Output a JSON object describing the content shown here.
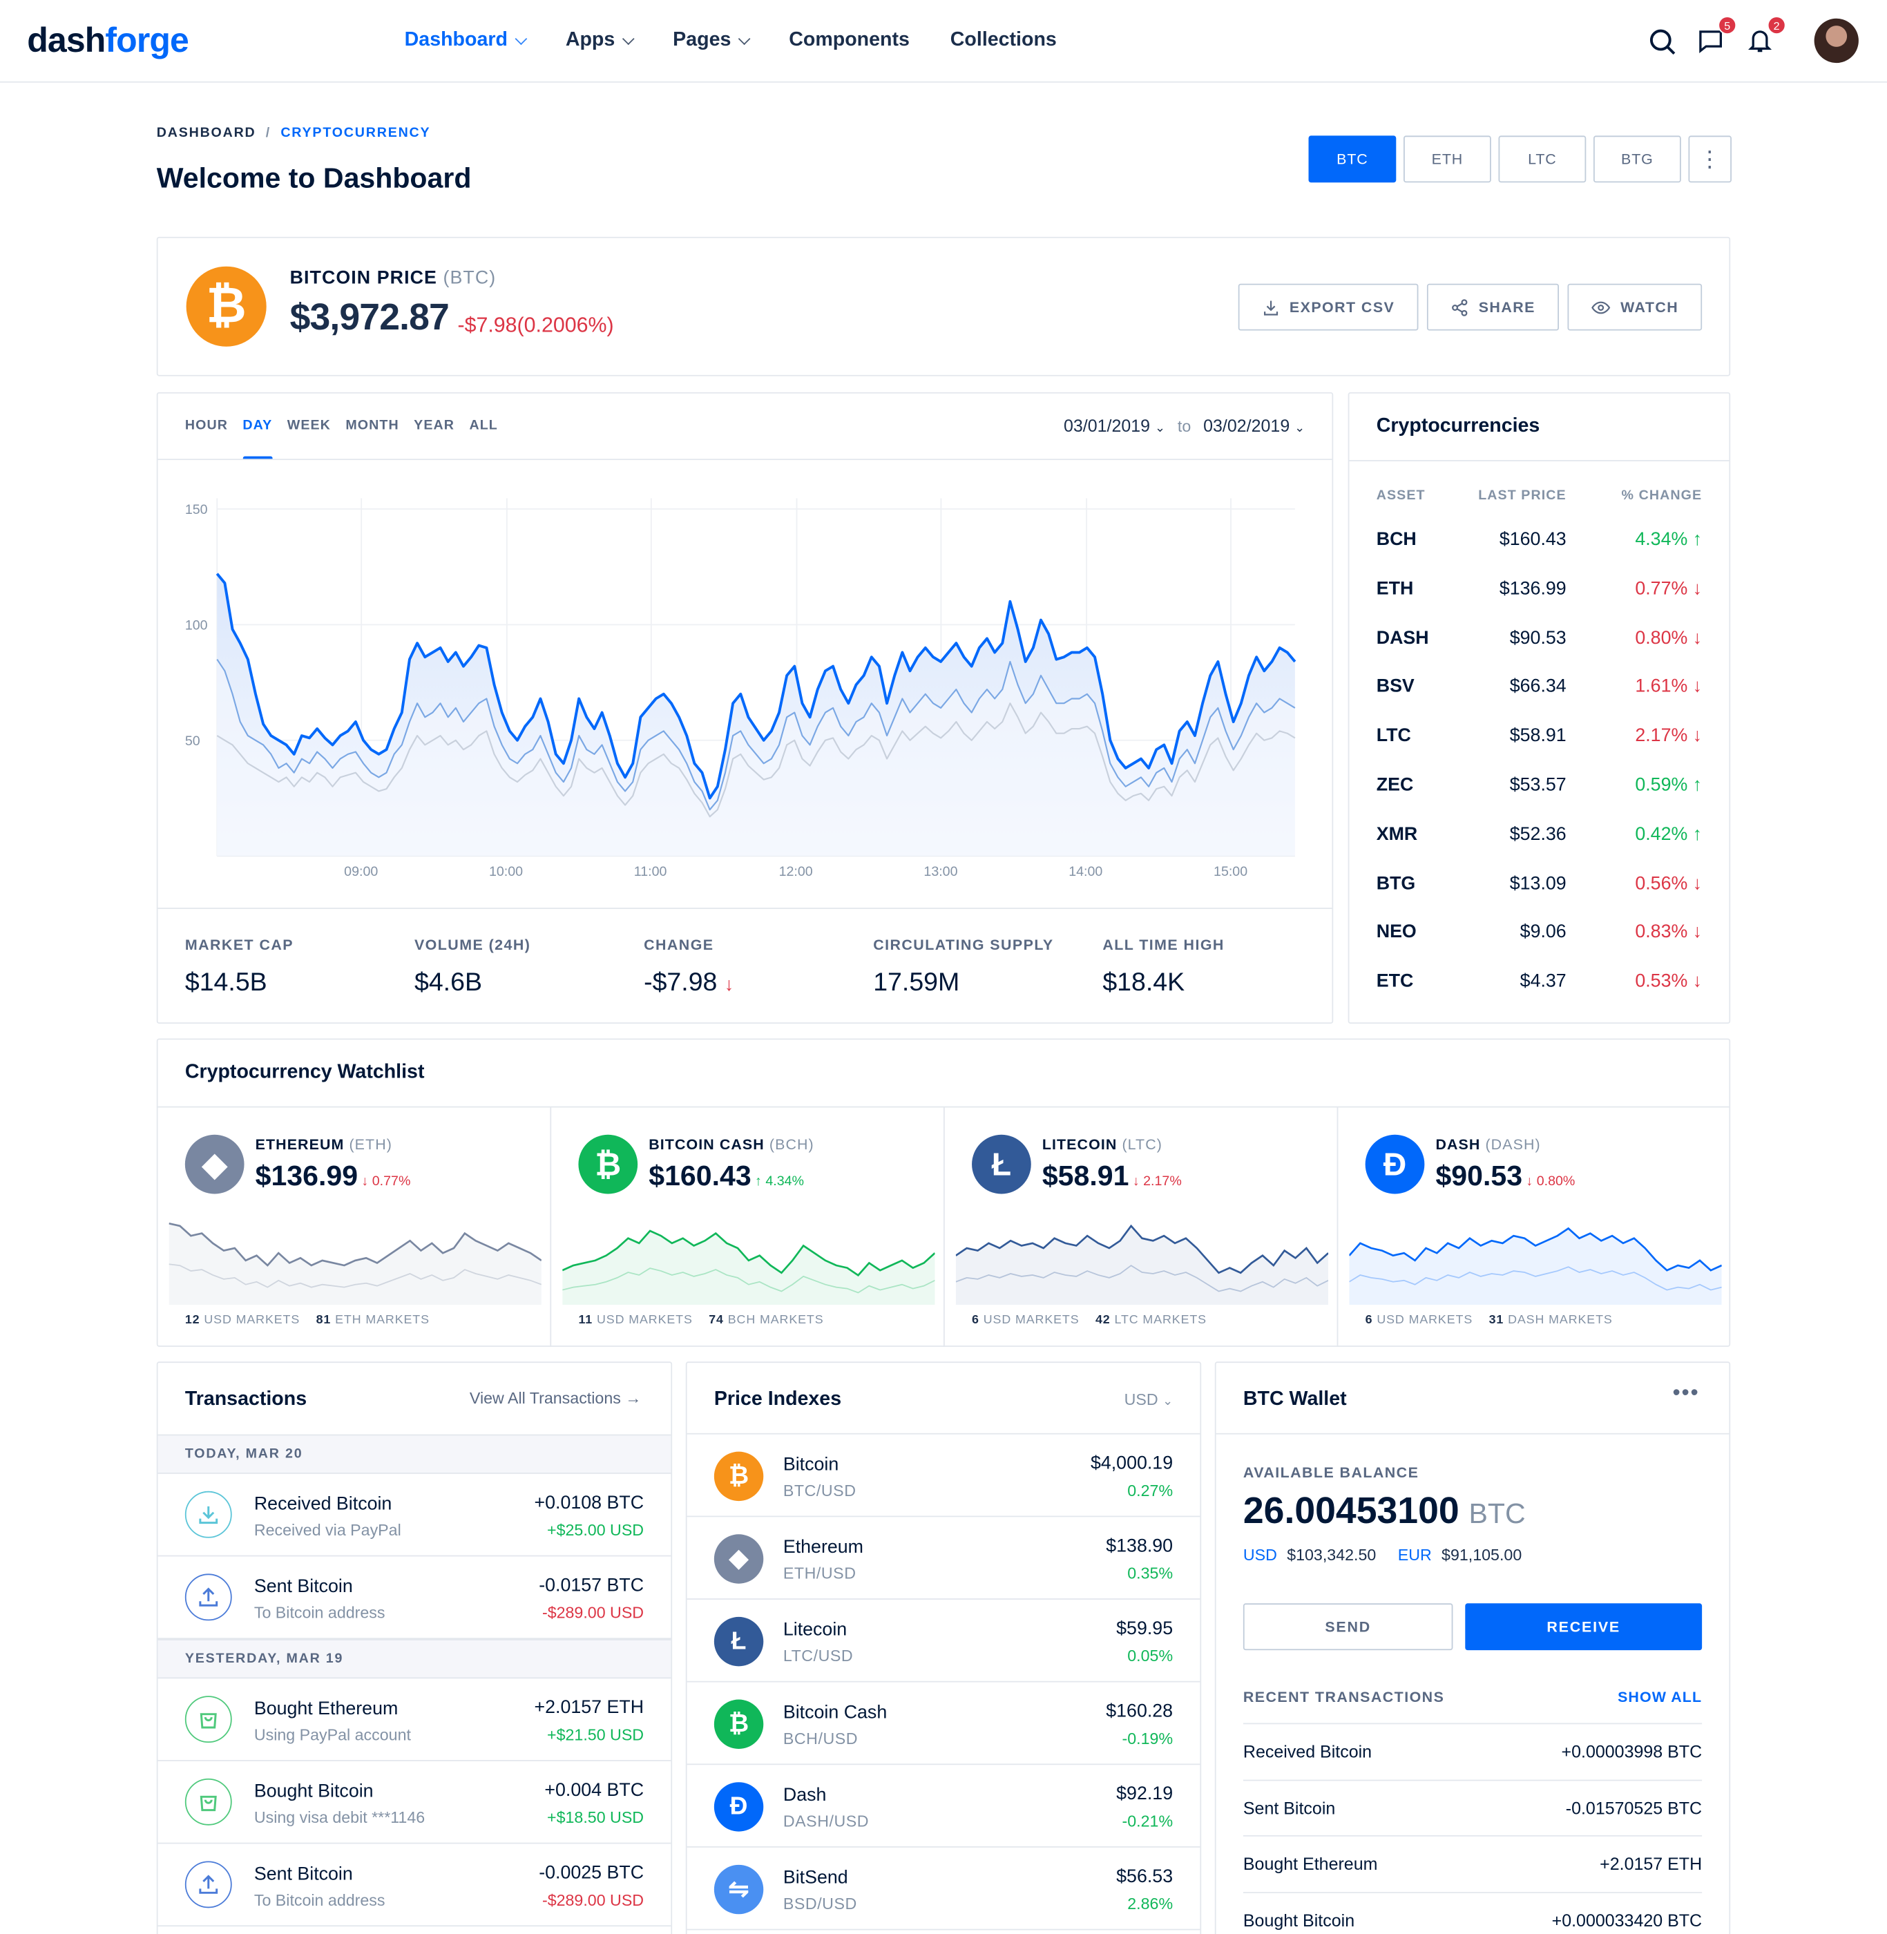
{
  "header": {
    "logo_a": "dash",
    "logo_b": "forge",
    "nav": [
      {
        "label": "Dashboard",
        "dropdown": true,
        "active": true
      },
      {
        "label": "Apps",
        "dropdown": true
      },
      {
        "label": "Pages",
        "dropdown": true
      },
      {
        "label": "Components",
        "dropdown": false
      },
      {
        "label": "Collections",
        "dropdown": false
      }
    ],
    "messages_badge": "5",
    "notifications_badge": "2"
  },
  "breadcrumb": {
    "root": "DASHBOARD",
    "sep": "/",
    "current": "CRYPTOCURRENCY"
  },
  "page_title": "Welcome to Dashboard",
  "coin_tabs": {
    "btc": "BTC",
    "eth": "ETH",
    "ltc": "LTC",
    "btg": "BTG",
    "more": "⋮"
  },
  "price_card": {
    "symbol": "₿",
    "title": "BITCOIN PRICE",
    "ticker": "(BTC)",
    "price": "$3,972.87",
    "change": "-$7.98(0.2006%)",
    "buttons": {
      "export": "EXPORT CSV",
      "share": "SHARE",
      "watch": "WATCH"
    }
  },
  "chart": {
    "ranges": [
      "HOUR",
      "DAY",
      "WEEK",
      "MONTH",
      "YEAR",
      "ALL"
    ],
    "active_range": "DAY",
    "date_from": "03/01/2019",
    "date_to": "03/02/2019",
    "to": "to"
  },
  "chart_data": {
    "type": "area",
    "x_ticks": [
      "09:00",
      "10:00",
      "11:00",
      "12:00",
      "13:00",
      "14:00",
      "15:00"
    ],
    "y_ticks": [
      "150",
      "100",
      "50"
    ],
    "ylim": [
      0,
      150
    ],
    "grid": true,
    "series": [
      {
        "values": [
          122,
          118,
          98,
          92,
          85,
          70,
          57,
          52,
          50,
          48,
          44,
          52,
          51,
          55,
          51,
          48,
          52,
          54,
          58,
          50,
          46,
          44,
          46,
          55,
          62,
          85,
          92,
          86,
          88,
          90,
          84,
          88,
          82,
          86,
          91,
          90,
          74,
          62,
          54,
          50,
          56,
          60,
          68,
          58,
          44,
          40,
          50,
          68,
          60,
          55,
          62,
          52,
          40,
          34,
          40,
          60,
          64,
          68,
          70,
          66,
          60,
          52,
          40,
          36,
          25,
          30,
          46,
          66,
          70,
          60,
          55,
          50,
          54,
          62,
          78,
          82,
          66,
          60,
          72,
          80,
          82,
          72,
          66,
          74,
          78,
          86,
          82,
          66,
          78,
          88,
          80,
          86,
          90,
          86,
          84,
          88,
          92,
          86,
          82,
          90,
          94,
          88,
          92,
          110,
          98,
          84,
          90,
          102,
          96,
          85,
          86,
          88,
          88,
          90,
          86,
          70,
          50,
          42,
          38,
          40,
          42,
          38,
          46,
          48,
          40,
          54,
          58,
          52,
          66,
          78,
          84,
          70,
          58,
          66,
          78,
          86,
          80,
          84,
          90,
          88,
          84
        ]
      },
      {
        "values": [
          85,
          80,
          70,
          58,
          52,
          50,
          48,
          44,
          38,
          40,
          36,
          42,
          40,
          45,
          42,
          38,
          42,
          44,
          45,
          40,
          36,
          34,
          36,
          44,
          48,
          58,
          66,
          60,
          62,
          66,
          60,
          64,
          58,
          62,
          66,
          68,
          56,
          48,
          42,
          40,
          44,
          46,
          52,
          44,
          36,
          32,
          38,
          52,
          46,
          44,
          48,
          40,
          32,
          28,
          32,
          46,
          50,
          52,
          54,
          50,
          46,
          40,
          32,
          28,
          20,
          24,
          36,
          52,
          54,
          48,
          44,
          40,
          42,
          48,
          60,
          62,
          52,
          48,
          56,
          62,
          64,
          56,
          52,
          58,
          60,
          66,
          62,
          52,
          60,
          68,
          62,
          66,
          70,
          66,
          64,
          68,
          72,
          66,
          62,
          68,
          72,
          68,
          72,
          84,
          74,
          66,
          70,
          78,
          72,
          66,
          66,
          68,
          68,
          70,
          66,
          54,
          40,
          34,
          30,
          32,
          34,
          30,
          36,
          38,
          32,
          42,
          46,
          40,
          50,
          60,
          64,
          54,
          46,
          52,
          60,
          66,
          62,
          64,
          68,
          66,
          64
        ]
      },
      {
        "values": [
          52,
          50,
          48,
          44,
          40,
          38,
          36,
          34,
          32,
          34,
          30,
          34,
          32,
          36,
          34,
          30,
          34,
          35,
          36,
          32,
          30,
          28,
          29,
          34,
          38,
          46,
          52,
          48,
          50,
          52,
          48,
          50,
          46,
          48,
          52,
          54,
          44,
          38,
          34,
          32,
          35,
          37,
          42,
          36,
          30,
          26,
          30,
          42,
          38,
          36,
          38,
          32,
          26,
          22,
          26,
          36,
          40,
          42,
          44,
          40,
          38,
          33,
          27,
          23,
          17,
          20,
          29,
          42,
          44,
          39,
          36,
          33,
          34,
          38,
          48,
          50,
          42,
          39,
          45,
          50,
          51,
          45,
          42,
          46,
          48,
          52,
          50,
          42,
          48,
          54,
          50,
          53,
          56,
          53,
          51,
          54,
          58,
          53,
          50,
          54,
          58,
          55,
          58,
          66,
          60,
          53,
          56,
          62,
          58,
          53,
          53,
          55,
          55,
          56,
          53,
          43,
          32,
          27,
          24,
          26,
          27,
          24,
          29,
          30,
          26,
          34,
          37,
          32,
          40,
          48,
          51,
          43,
          37,
          42,
          48,
          53,
          50,
          51,
          54,
          53,
          51
        ]
      }
    ]
  },
  "stats": [
    {
      "label": "MARKET CAP",
      "value": "$14.5B"
    },
    {
      "label": "VOLUME (24H)",
      "value": "$4.6B"
    },
    {
      "label": "CHANGE",
      "value": "-$7.98",
      "arrow": "↓"
    },
    {
      "label": "CIRCULATING SUPPLY",
      "value": "17.59M"
    },
    {
      "label": "ALL TIME HIGH",
      "value": "$18.4K"
    }
  ],
  "cryptos": {
    "title": "Cryptocurrencies",
    "headers": {
      "asset": "ASSET",
      "price": "LAST PRICE",
      "change": "% CHANGE"
    },
    "rows": [
      {
        "sym": "BCH",
        "price": "$160.43",
        "change": "4.34% ↑",
        "up": true
      },
      {
        "sym": "ETH",
        "price": "$136.99",
        "change": "0.77% ↓",
        "up": false
      },
      {
        "sym": "DASH",
        "price": "$90.53",
        "change": "0.80% ↓",
        "up": false
      },
      {
        "sym": "BSV",
        "price": "$66.34",
        "change": "1.61% ↓",
        "up": false
      },
      {
        "sym": "LTC",
        "price": "$58.91",
        "change": "2.17% ↓",
        "up": false
      },
      {
        "sym": "ZEC",
        "price": "$53.57",
        "change": "0.59% ↑",
        "up": true
      },
      {
        "sym": "XMR",
        "price": "$52.36",
        "change": "0.42% ↑",
        "up": true
      },
      {
        "sym": "BTG",
        "price": "$13.09",
        "change": "0.56% ↓",
        "up": false
      },
      {
        "sym": "NEO",
        "price": "$9.06",
        "change": "0.83% ↓",
        "up": false
      },
      {
        "sym": "ETC",
        "price": "$4.37",
        "change": "0.53% ↓",
        "up": false
      }
    ]
  },
  "watchlist": {
    "title": "Cryptocurrency Watchlist",
    "items": [
      {
        "name": "ETHEREUM",
        "ticker": "(ETH)",
        "icon": "◆",
        "color": "#7987a1",
        "price": "$136.99",
        "change": "↓ 0.77%",
        "up": false,
        "m1": "12",
        "m1l": "USD MARKETS",
        "m2": "81",
        "m2l": "ETH MARKETS"
      },
      {
        "name": "BITCOIN CASH",
        "ticker": "(BCH)",
        "icon": "₿",
        "color": "#10b759",
        "price": "$160.43",
        "change": "↑ 4.34%",
        "up": true,
        "m1": "11",
        "m1l": "USD MARKETS",
        "m2": "74",
        "m2l": "BCH MARKETS"
      },
      {
        "name": "LITECOIN",
        "ticker": "(LTC)",
        "icon": "Ł",
        "color": "#325a98",
        "price": "$58.91",
        "change": "↓ 2.17%",
        "up": false,
        "m1": "6",
        "m1l": "USD MARKETS",
        "m2": "42",
        "m2l": "LTC MARKETS"
      },
      {
        "name": "DASH",
        "ticker": "(DASH)",
        "icon": "Đ",
        "color": "#0168fa",
        "price": "$90.53",
        "change": "↓ 0.80%",
        "up": false,
        "m1": "6",
        "m1l": "USD MARKETS",
        "m2": "31",
        "m2l": "DASH MARKETS"
      }
    ]
  },
  "transactions": {
    "title": "Transactions",
    "view_all": "View All Transactions →",
    "groups": [
      {
        "date": "TODAY, MAR 20",
        "rows": [
          {
            "title": "Received Bitcoin",
            "sub": "Received via PayPal",
            "amount": "+0.0108 BTC",
            "usd": "+$25.00 USD",
            "up": true,
            "icon": "receive",
            "color": "#5bc5d8"
          },
          {
            "title": "Sent Bitcoin",
            "sub": "To Bitcoin address",
            "amount": "-0.0157 BTC",
            "usd": "-$289.00 USD",
            "up": false,
            "icon": "send",
            "color": "#4b7bd8"
          }
        ]
      },
      {
        "date": "YESTERDAY, MAR 19",
        "rows": [
          {
            "title": "Bought Ethereum",
            "sub": "Using PayPal account",
            "amount": "+2.0157 ETH",
            "usd": "+$21.50 USD",
            "up": true,
            "icon": "bag",
            "color": "#4fc97c"
          },
          {
            "title": "Bought Bitcoin",
            "sub": "Using visa debit ***1146",
            "amount": "+0.004 BTC",
            "usd": "+$18.50 USD",
            "up": true,
            "icon": "bag",
            "color": "#4fc97c"
          },
          {
            "title": "Sent Bitcoin",
            "sub": "To Bitcoin address",
            "amount": "-0.0025 BTC",
            "usd": "-$289.00 USD",
            "up": false,
            "icon": "send",
            "color": "#4b7bd8"
          }
        ]
      }
    ]
  },
  "price_indexes": {
    "title": "Price Indexes",
    "currency": "USD",
    "rows": [
      {
        "name": "Bitcoin",
        "pair": "BTC/USD",
        "price": "$4,000.19",
        "change": "0.27%",
        "up": true,
        "icon": "₿",
        "color": "#f7931a"
      },
      {
        "name": "Ethereum",
        "pair": "ETH/USD",
        "price": "$138.90",
        "change": "0.35%",
        "up": true,
        "icon": "◆",
        "color": "#7987a1"
      },
      {
        "name": "Litecoin",
        "pair": "LTC/USD",
        "price": "$59.95",
        "change": "0.05%",
        "up": true,
        "icon": "Ł",
        "color": "#325a98"
      },
      {
        "name": "Bitcoin Cash",
        "pair": "BCH/USD",
        "price": "$160.28",
        "change": "-0.19%",
        "up": true,
        "icon": "₿",
        "color": "#10b759"
      },
      {
        "name": "Dash",
        "pair": "DASH/USD",
        "price": "$92.19",
        "change": "-0.21%",
        "up": true,
        "icon": "Đ",
        "color": "#0168fa"
      },
      {
        "name": "BitSend",
        "pair": "BSD/USD",
        "price": "$56.53",
        "change": "2.86%",
        "up": true,
        "icon": "⇋",
        "color": "#4a90f2"
      }
    ]
  },
  "wallet": {
    "title": "BTC Wallet",
    "menu": "•••",
    "avail_label": "AVAILABLE BALANCE",
    "balance": "26.00453100",
    "unit": "BTC",
    "usd_k": "USD",
    "usd_v": "$103,342.50",
    "eur_k": "EUR",
    "eur_v": "$91,105.00",
    "send": "SEND",
    "receive": "RECEIVE",
    "recent_label": "RECENT TRANSACTIONS",
    "show_all": "SHOW ALL",
    "recent": [
      {
        "name": "Received Bitcoin",
        "value": "+0.00003998 BTC"
      },
      {
        "name": "Sent Bitcoin",
        "value": "-0.01570525 BTC"
      },
      {
        "name": "Bought Ethereum",
        "value": "+2.0157 ETH"
      },
      {
        "name": "Bought Bitcoin",
        "value": "+0.000033420 BTC"
      }
    ]
  }
}
